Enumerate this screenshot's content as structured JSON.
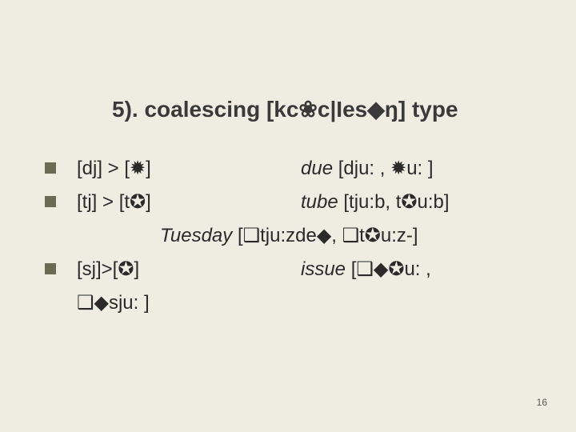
{
  "slide": {
    "title": "5). coalescing [kc❀c|Ies◆ŋ] type",
    "items": [
      {
        "lhs": "[dj] > [✹]",
        "rhs_label_italic": "due ",
        "rhs_rest": "[dju: , ✹u: ]"
      },
      {
        "lhs": "[tj] > [t✪]",
        "rhs_label_italic": "tube ",
        "rhs_rest": "[tju:b, t✪u:b]"
      }
    ],
    "subline_italic": "Tuesday ",
    "subline_rest": "[❑tju:zde◆, ❑t✪u:z-]",
    "item3": {
      "lhs": "[sj]>[✪]",
      "rhs_label_italic": "issue ",
      "rhs_rest": "[❑◆✪u: ,"
    },
    "tail": "❑◆sju: ]",
    "pagenum": "16"
  }
}
